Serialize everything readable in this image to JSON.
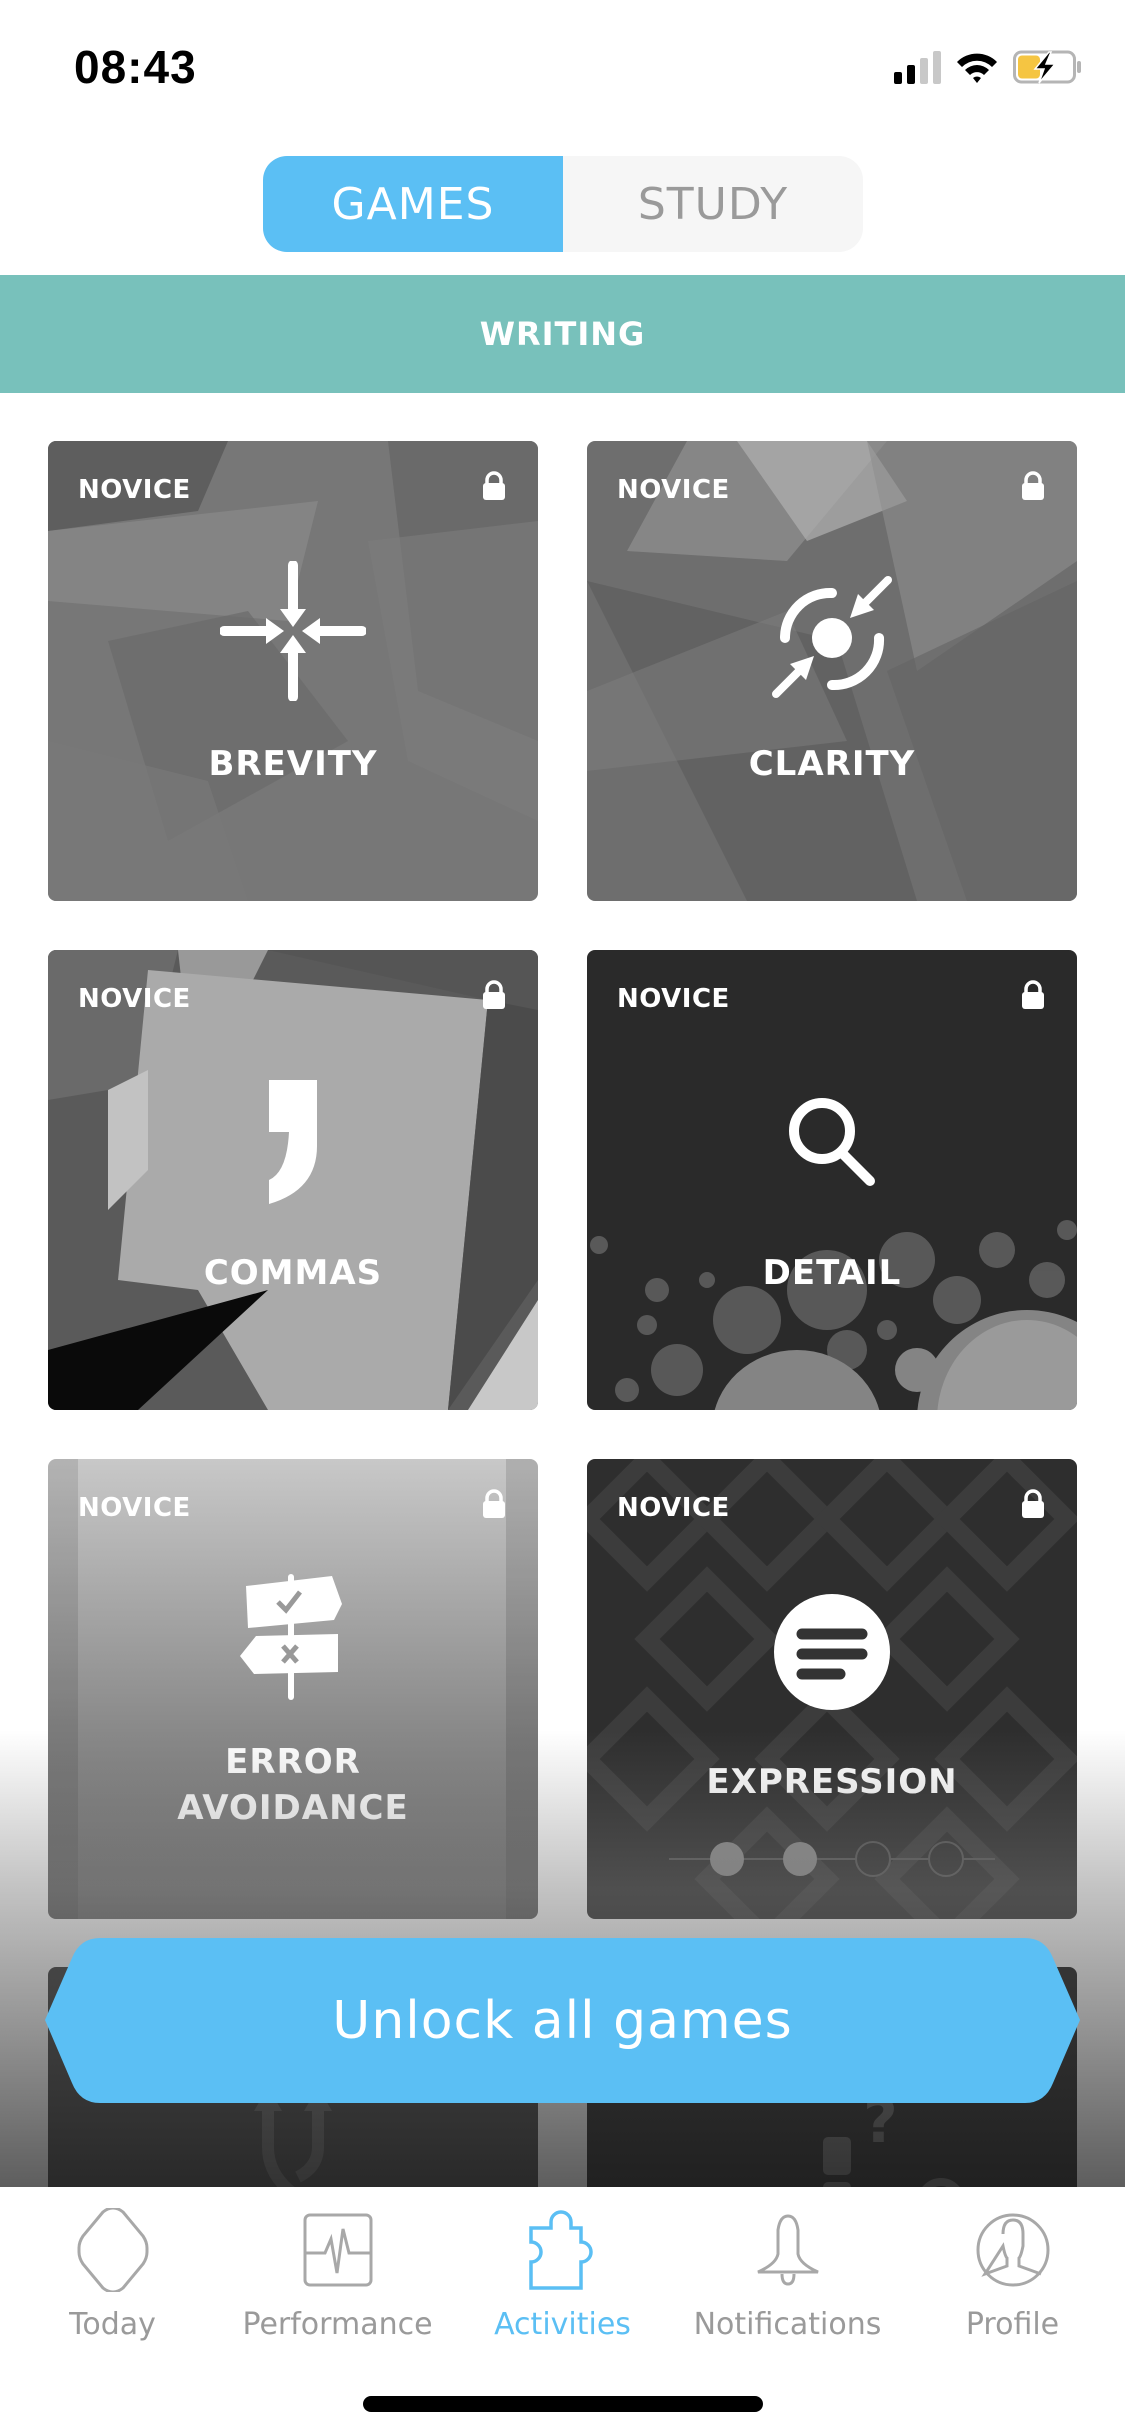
{
  "status_bar": {
    "time": "08:43",
    "battery_charging": true,
    "battery_color": "#f5c542"
  },
  "segment": {
    "tabs": [
      {
        "label": "GAMES",
        "active": true
      },
      {
        "label": "STUDY",
        "active": false
      }
    ]
  },
  "category": {
    "title": "WRITING",
    "color": "#78c1bb"
  },
  "games": [
    {
      "level": "NOVICE",
      "name": "BREVITY",
      "icon": "compress-arrows-icon",
      "locked": true
    },
    {
      "level": "NOVICE",
      "name": "CLARITY",
      "icon": "focus-target-icon",
      "locked": true
    },
    {
      "level": "NOVICE",
      "name": "COMMAS",
      "icon": "comma-icon",
      "locked": true
    },
    {
      "level": "NOVICE",
      "name": "DETAIL",
      "icon": "magnifier-icon",
      "locked": true
    },
    {
      "level": "NOVICE",
      "name": "ERROR",
      "name2": "AVOIDANCE",
      "icon": "signpost-icon",
      "locked": true
    },
    {
      "level": "NOVICE",
      "name": "EXPRESSION",
      "icon": "text-bubble-icon",
      "locked": true,
      "progress_dots": {
        "filled": 2,
        "total": 4
      }
    },
    {
      "icon": "merge-arrows-icon"
    },
    {
      "icon": "question-blocks-icon"
    }
  ],
  "unlock_button": {
    "label": "Unlock all games",
    "color": "#5bbff4"
  },
  "tabbar": {
    "accent": "#5bbff4",
    "items": [
      {
        "label": "Today",
        "icon": "hexagon-icon",
        "active": false
      },
      {
        "label": "Performance",
        "icon": "pulse-chart-icon",
        "active": false
      },
      {
        "label": "Activities",
        "icon": "puzzle-icon",
        "active": true
      },
      {
        "label": "Notifications",
        "icon": "bell-icon",
        "active": false
      },
      {
        "label": "Profile",
        "icon": "profile-icon",
        "active": false
      }
    ]
  }
}
